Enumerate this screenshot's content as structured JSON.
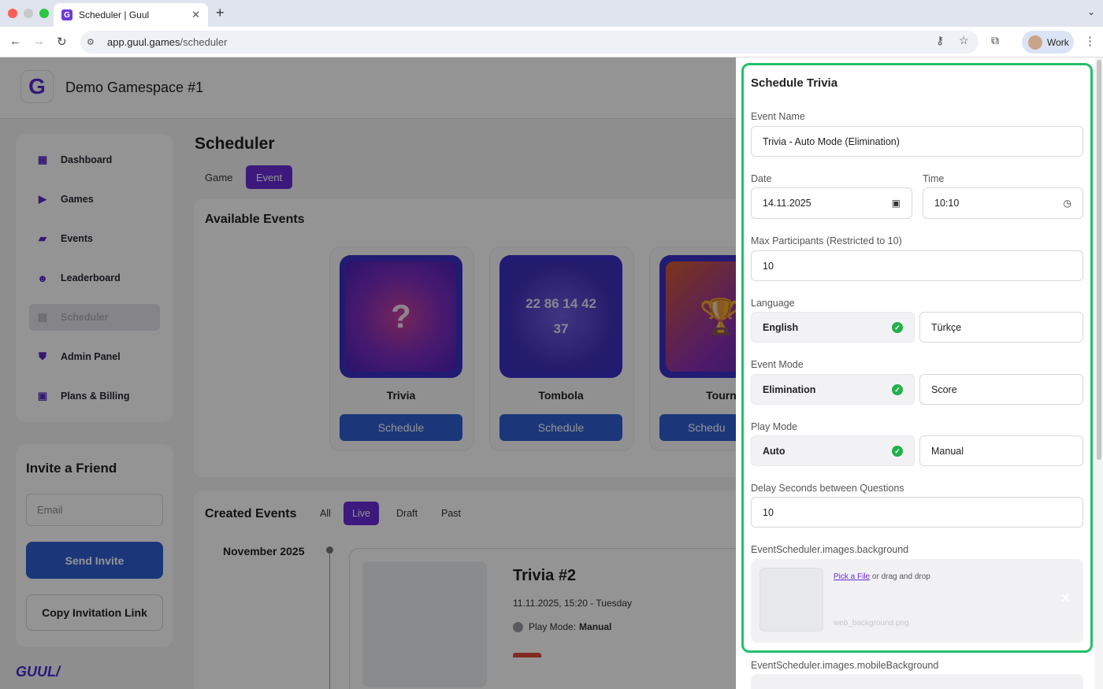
{
  "browser": {
    "tab_title": "Scheduler | Guul",
    "tab_favicon": "G",
    "url_host": "app.guul.games",
    "url_path": "/scheduler",
    "profile_label": "Work"
  },
  "app": {
    "logo_letter": "G",
    "gamespace": "Demo Gamespace #1",
    "brand": "GUUL/",
    "accent": "#5b2ad0",
    "primary_button": "#2f5fd3"
  },
  "sidebar": {
    "items": [
      {
        "label": "Dashboard",
        "icon": "dashboard-icon"
      },
      {
        "label": "Games",
        "icon": "play-icon"
      },
      {
        "label": "Events",
        "icon": "ticket-icon"
      },
      {
        "label": "Leaderboard",
        "icon": "people-icon"
      },
      {
        "label": "Scheduler",
        "icon": "calendar-icon",
        "active": true
      },
      {
        "label": "Admin Panel",
        "icon": "shield-icon"
      },
      {
        "label": "Plans & Billing",
        "icon": "billing-icon"
      }
    ]
  },
  "invite": {
    "title": "Invite a Friend",
    "email_placeholder": "Email",
    "send_label": "Send Invite",
    "copy_label": "Copy Invitation Link"
  },
  "main": {
    "title": "Scheduler",
    "tabs": [
      {
        "label": "Game",
        "active": false
      },
      {
        "label": "Event",
        "active": true
      }
    ],
    "available": {
      "title": "Available Events",
      "cards": [
        {
          "name": "Trivia",
          "button": "Schedule",
          "art": "?"
        },
        {
          "name": "Tombola",
          "button": "Schedule",
          "art": "22 86 14 42 37"
        },
        {
          "name": "Tournam",
          "button": "Schedu",
          "art": "trophy"
        }
      ]
    },
    "created": {
      "title": "Created Events",
      "filters": [
        {
          "label": "All",
          "active": false
        },
        {
          "label": "Live",
          "active": true
        },
        {
          "label": "Draft",
          "active": false
        },
        {
          "label": "Past",
          "active": false
        }
      ],
      "month": "November 2025",
      "event": {
        "title": "Trivia #2",
        "datetime": "11.11.2025, 15:20 - Tuesday",
        "play_mode_label": "Play Mode:",
        "play_mode_value": "Manual"
      }
    }
  },
  "drawer": {
    "title": "Schedule Trivia",
    "event_name_label": "Event Name",
    "event_name_value": "Trivia - Auto Mode (Elimination)",
    "date_label": "Date",
    "date_value": "14.11.2025",
    "time_label": "Time",
    "time_value": "10:10",
    "max_participants_label": "Max Participants (Restricted to 10)",
    "max_participants_value": "10",
    "language_label": "Language",
    "language_options": [
      {
        "label": "English",
        "selected": true
      },
      {
        "label": "Türkçe",
        "selected": false
      }
    ],
    "event_mode_label": "Event Mode",
    "event_mode_options": [
      {
        "label": "Elimination",
        "selected": true
      },
      {
        "label": "Score",
        "selected": false
      }
    ],
    "play_mode_label": "Play Mode",
    "play_mode_options": [
      {
        "label": "Auto",
        "selected": true
      },
      {
        "label": "Manual",
        "selected": false
      }
    ],
    "delay_label": "Delay Seconds between Questions",
    "delay_value": "10",
    "background_label": "EventScheduler.images.background",
    "pick_file": "Pick a File",
    "drag_drop": " or drag and drop",
    "background_filename": "web_background.png",
    "mobile_background_label": "EventScheduler.images.mobileBackground",
    "check_color": "#22b04b",
    "focus_color": "#22c06a"
  }
}
